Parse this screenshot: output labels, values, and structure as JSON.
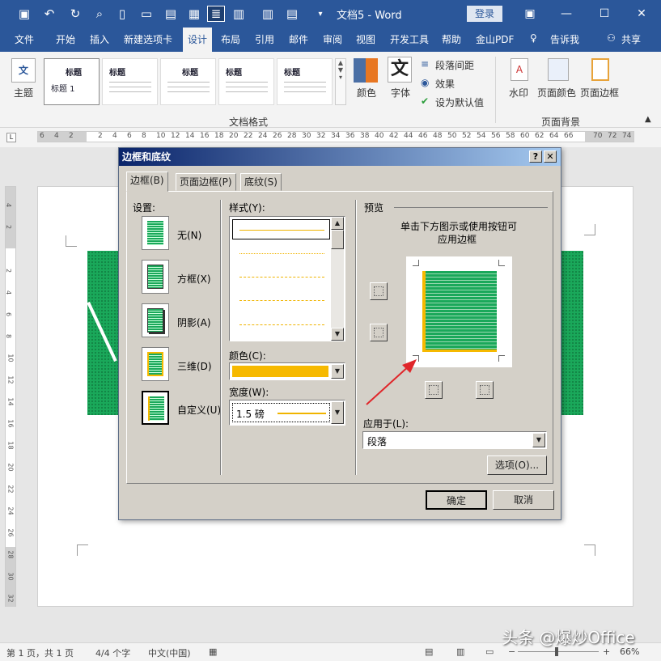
{
  "titlebar": {
    "doc_title": "文档5 - Word",
    "login": "登录"
  },
  "tabs": [
    "文件",
    "开始",
    "插入",
    "新建选项卡",
    "设计",
    "布局",
    "引用",
    "邮件",
    "审阅",
    "视图",
    "开发工具",
    "帮助",
    "金山PDF",
    "告诉我",
    "共享"
  ],
  "ribbon": {
    "theme_label": "主题",
    "gallery": [
      {
        "title": "标题",
        "sub": "标题 1"
      },
      {
        "title": "标题"
      },
      {
        "title": "标题"
      },
      {
        "title": "标题"
      },
      {
        "title": "标题"
      }
    ],
    "colors_label": "颜色",
    "fonts_label": "字体",
    "para_spacing": "段落间距",
    "effects": "效果",
    "set_default": "设为默认值",
    "group_format": "文档格式",
    "watermark": "水印",
    "page_color": "页面颜色",
    "page_border": "页面边框",
    "group_bg": "页面背景"
  },
  "ruler_ticks": [
    "6",
    "4",
    "2",
    "",
    "2",
    "4",
    "6",
    "8",
    "10",
    "12",
    "14",
    "16",
    "18",
    "20",
    "22",
    "24",
    "26",
    "28",
    "30",
    "32",
    "34",
    "36",
    "38",
    "40",
    "42",
    "44",
    "46",
    "48",
    "50",
    "52",
    "54",
    "56",
    "58",
    "60",
    "62",
    "64",
    "66",
    "",
    "70",
    "72",
    "74"
  ],
  "vruler_ticks": [
    "4",
    "2",
    "",
    "2",
    "4",
    "6",
    "8",
    "10",
    "12",
    "14",
    "16",
    "18",
    "20",
    "22",
    "24",
    "26",
    "28",
    "30",
    "32"
  ],
  "dialog": {
    "title": "边框和底纹",
    "help": "?",
    "close": "✕",
    "tabs": {
      "border": "边框(B)",
      "page_border": "页面边框(P)",
      "shading": "底纹(S)"
    },
    "settings_label": "设置:",
    "settings": [
      "无(N)",
      "方框(X)",
      "阴影(A)",
      "三维(D)",
      "自定义(U)"
    ],
    "style_label": "样式(Y):",
    "color_label": "颜色(C):",
    "color_value": "#f6b900",
    "width_label": "宽度(W):",
    "width_value": "1.5 磅",
    "preview_label": "预览",
    "preview_hint1": "单击下方图示或使用按钮可",
    "preview_hint2": "应用边框",
    "apply_label": "应用于(L):",
    "apply_value": "段落",
    "options": "选项(O)...",
    "ok": "确定",
    "cancel": "取消"
  },
  "status": {
    "page": "第 1 页，共 1 页",
    "words": "4/4 个字",
    "lang": "中文(中国)",
    "zoom": "66%"
  },
  "watermark": "头条 @爆炒Office"
}
